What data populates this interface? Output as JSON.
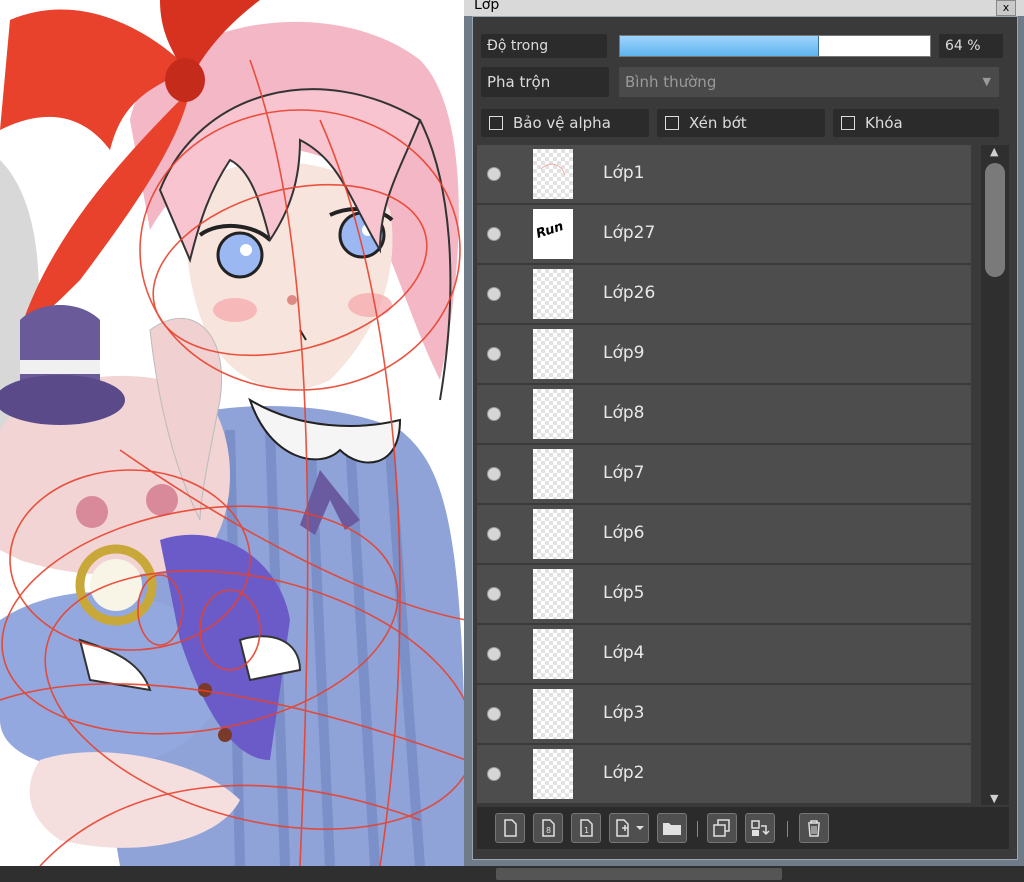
{
  "panel": {
    "title": "Lớp",
    "close_label": "x",
    "opacity_label": "Độ trong",
    "opacity_value": "64 %",
    "opacity_fraction": 0.64,
    "blend_label": "Pha trộn",
    "blend_value": "Bình thường",
    "checkboxes": [
      {
        "label": "Bảo vệ alpha",
        "checked": false
      },
      {
        "label": "Xén bớt",
        "checked": false
      },
      {
        "label": "Khóa",
        "checked": false
      }
    ],
    "layers": [
      {
        "name": "Lớp1",
        "thumb": "faint-red-sketch"
      },
      {
        "name": "Lớp27",
        "thumb": "run-text"
      },
      {
        "name": "Lớp26",
        "thumb": "empty"
      },
      {
        "name": "Lớp9",
        "thumb": "faint-sketch"
      },
      {
        "name": "Lớp8",
        "thumb": "empty"
      },
      {
        "name": "Lớp7",
        "thumb": "empty"
      },
      {
        "name": "Lớp6",
        "thumb": "empty"
      },
      {
        "name": "Lớp5",
        "thumb": "faint-sketch"
      },
      {
        "name": "Lớp4",
        "thumb": "faint-sketch"
      },
      {
        "name": "Lớp3",
        "thumb": "faint-sketch"
      },
      {
        "name": "Lớp2",
        "thumb": "faint-sketch"
      }
    ],
    "thumb_text": "Run",
    "toolbar": [
      {
        "icon": "new-layer-icon",
        "glyph": "🗋"
      },
      {
        "icon": "layer-8bit-icon",
        "glyph": "8"
      },
      {
        "icon": "layer-1bit-icon",
        "glyph": "1"
      },
      {
        "icon": "add-special-layer-icon",
        "glyph": "+▾"
      },
      {
        "icon": "folder-icon",
        "glyph": "▬"
      },
      {
        "icon": "duplicate-layer-icon",
        "glyph": "⧉"
      },
      {
        "icon": "merge-down-icon",
        "glyph": "⇲"
      },
      {
        "icon": "delete-layer-icon",
        "glyph": "🗑"
      }
    ]
  },
  "colors": {
    "panel_bg": "#3a3a3a",
    "row_bg": "#4d4d4d",
    "opacity_fill": "#5fb4ee",
    "accent_red": "#e8412c"
  }
}
